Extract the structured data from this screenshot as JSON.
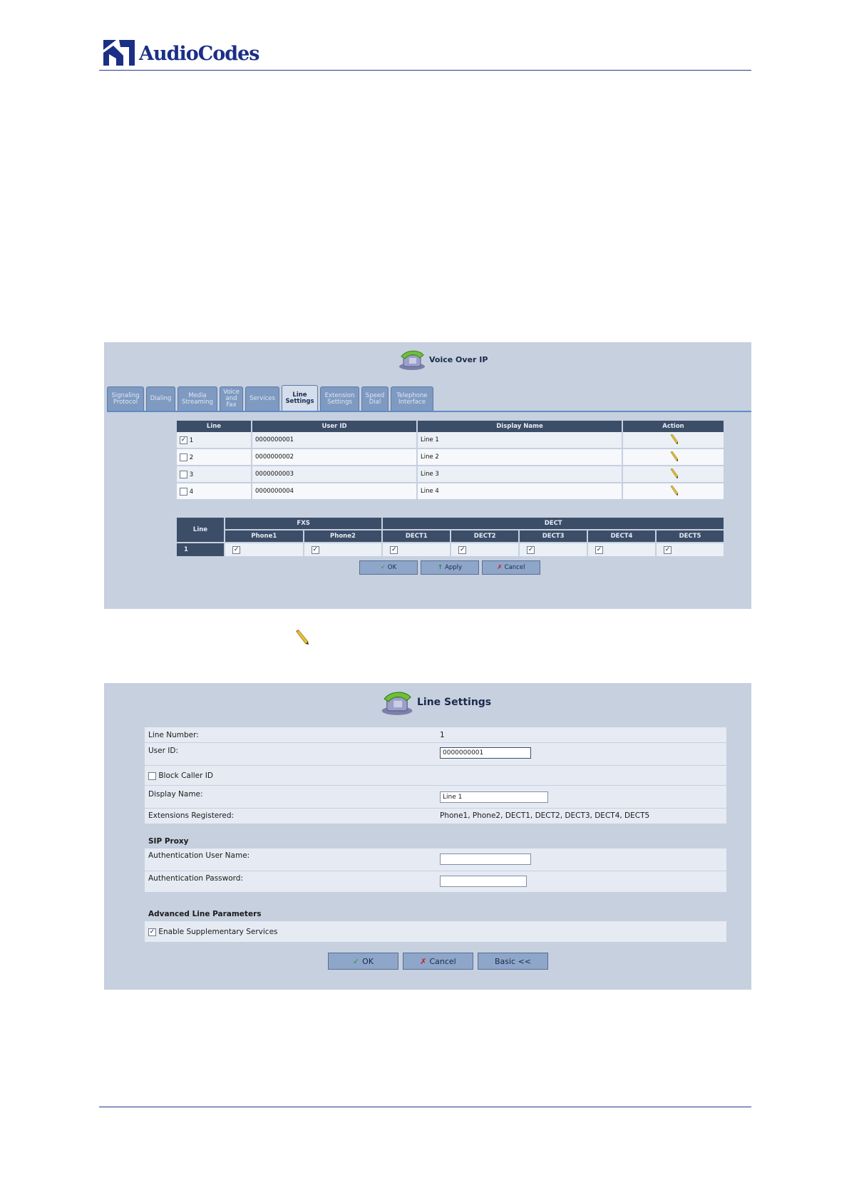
{
  "header": {
    "brand": "AudioCodes"
  },
  "voip": {
    "title": "Voice Over IP",
    "tabs": [
      {
        "label": "Signaling Protocol"
      },
      {
        "label": "Dialing"
      },
      {
        "label": "Media Streaming"
      },
      {
        "label": "Voice and Fax"
      },
      {
        "label": "Services"
      },
      {
        "label": "Line Settings",
        "active": true
      },
      {
        "label": "Extension Settings"
      },
      {
        "label": "Speed Dial"
      },
      {
        "label": "Telephone Interface"
      }
    ],
    "lines_table": {
      "columns": [
        "Line",
        "User ID",
        "Display Name",
        "Action"
      ],
      "rows": [
        {
          "line": "1",
          "checked": true,
          "user_id": "0000000001",
          "display_name": "Line 1",
          "action_icon": "pencil-icon"
        },
        {
          "line": "2",
          "checked": false,
          "user_id": "0000000002",
          "display_name": "Line 2",
          "action_icon": "pencil-icon"
        },
        {
          "line": "3",
          "checked": false,
          "user_id": "0000000003",
          "display_name": "Line 3",
          "action_icon": "pencil-icon"
        },
        {
          "line": "4",
          "checked": false,
          "user_id": "0000000004",
          "display_name": "Line 4",
          "action_icon": "pencil-icon"
        }
      ]
    },
    "ext_table": {
      "line_header": "Line",
      "group_fxs": "FXS",
      "group_dect": "DECT",
      "columns": [
        "Phone1",
        "Phone2",
        "DECT1",
        "DECT2",
        "DECT3",
        "DECT4",
        "DECT5"
      ],
      "rows": [
        {
          "line": "1",
          "values": [
            true,
            true,
            true,
            true,
            true,
            true,
            true
          ]
        }
      ]
    },
    "buttons": {
      "ok": "OK",
      "apply": "Apply",
      "cancel": "Cancel"
    }
  },
  "line_settings": {
    "title": "Line Settings",
    "line_number_label": "Line Number:",
    "line_number_value": "1",
    "user_id_label": "User ID:",
    "user_id_value": "0000000001",
    "block_caller_id_label": "Block Caller ID",
    "block_caller_id_checked": false,
    "display_name_label": "Display Name:",
    "display_name_value": "Line 1",
    "extensions_label": "Extensions Registered:",
    "extensions_value": "Phone1, Phone2, DECT1, DECT2, DECT3, DECT4, DECT5",
    "sip_proxy_section": "SIP Proxy",
    "auth_user_label": "Authentication User Name:",
    "auth_user_value": "",
    "auth_pass_label": "Authentication Password:",
    "auth_pass_value": "",
    "advanced_section": "Advanced Line Parameters",
    "enable_supp_label": "Enable Supplementary Services",
    "enable_supp_checked": true,
    "buttons": {
      "ok": "OK",
      "cancel": "Cancel",
      "basic": "Basic <<"
    }
  }
}
